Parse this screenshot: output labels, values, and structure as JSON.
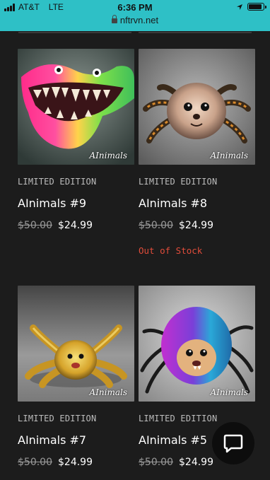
{
  "status": {
    "carrier": "AT&T",
    "network": "LTE",
    "time": "6:36 PM",
    "url": "nftrvn.net"
  },
  "products": [
    {
      "edition": "LIMITED EDITION",
      "name": "AInimals #9",
      "old_price": "$50.00",
      "price": "$24.99",
      "stock": "",
      "signature": "AInimals"
    },
    {
      "edition": "LIMITED EDITION",
      "name": "AInimals #8",
      "old_price": "$50.00",
      "price": "$24.99",
      "stock": "Out of Stock",
      "signature": "AInimals"
    },
    {
      "edition": "LIMITED EDITION",
      "name": "AInimals #7",
      "old_price": "$50.00",
      "price": "$24.99",
      "stock": "",
      "signature": "AInimals"
    },
    {
      "edition": "LIMITED EDITION",
      "name": "AInimals #5",
      "old_price": "$50.00",
      "price": "$24.99",
      "stock": "",
      "signature": "AInimals"
    }
  ],
  "colors": {
    "status_bar": "#2ec0c6",
    "background": "#1c1c1c",
    "out_of_stock": "#e04c3a"
  },
  "icons": {
    "chat": "chat-bubble-icon",
    "location": "location-arrow-icon",
    "lock": "lock-icon"
  }
}
